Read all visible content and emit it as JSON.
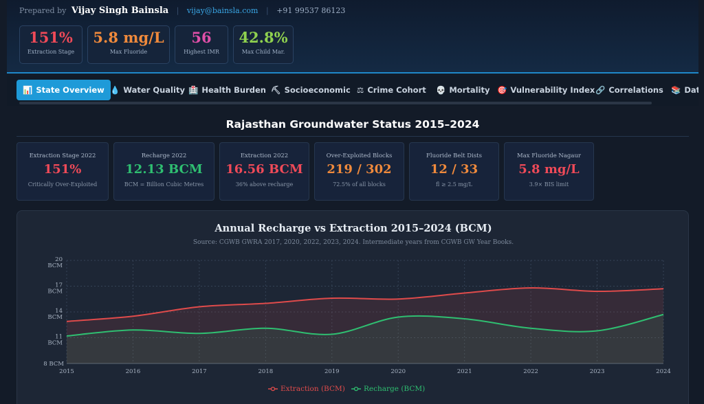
{
  "header": {
    "prepared_label": "Prepared by",
    "author": "Vijay Singh Bainsla",
    "email": "vijay@bainsla.com",
    "phone": "+91 99537 86123",
    "stats": [
      {
        "value": "151%",
        "label": "Extraction Stage",
        "color": "#ef4a58"
      },
      {
        "value": "5.8 mg/L",
        "label": "Max Fluoride",
        "color": "#f08a3c"
      },
      {
        "value": "56",
        "label": "Highest IMR",
        "color": "#e04fa8"
      },
      {
        "value": "42.8%",
        "label": "Max Child Mar.",
        "color": "#8fd14f"
      }
    ]
  },
  "tabs": [
    {
      "icon": "📊",
      "label": "State Overview",
      "active": true
    },
    {
      "icon": "💧",
      "label": "Water Quality"
    },
    {
      "icon": "🏥",
      "label": "Health Burden"
    },
    {
      "icon": "⛏",
      "label": "Socioeconomic"
    },
    {
      "icon": "⚖",
      "label": "Crime Cohort"
    },
    {
      "icon": "💀",
      "label": "Mortality"
    },
    {
      "icon": "🎯",
      "label": "Vulnerability Index"
    },
    {
      "icon": "🔗",
      "label": "Correlations"
    },
    {
      "icon": "📚",
      "label": "Data"
    }
  ],
  "page_title": "Rajasthan Groundwater Status 2015–2024",
  "cards": [
    {
      "label": "Extraction Stage 2022",
      "value": "151%",
      "sub": "Critically Over-Exploited",
      "color": "#ef4a58"
    },
    {
      "label": "Recharge 2022",
      "value": "12.13 BCM",
      "sub": "BCM = Billion Cubic Metres",
      "color": "#2fbf71"
    },
    {
      "label": "Extraction 2022",
      "value": "16.56 BCM",
      "sub": "36% above recharge",
      "color": "#ef4a58"
    },
    {
      "label": "Over-Exploited Blocks",
      "value": "219 / 302",
      "sub": "72.5% of all blocks",
      "color": "#f08a3c"
    },
    {
      "label": "Fluoride Belt Dists",
      "value": "12 / 33",
      "sub": "fl ≥ 2.5 mg/L",
      "color": "#f08a3c"
    },
    {
      "label": "Max Fluoride Nagaur",
      "value": "5.8 mg/L",
      "sub": "3.9× BIS limit",
      "color": "#ef4a58"
    }
  ],
  "chart_data": {
    "type": "line",
    "title": "Annual Recharge vs Extraction 2015–2024 (BCM)",
    "subtitle": "Source: CGWB GWRA 2017, 2020, 2022, 2023, 2024. Intermediate years from CGWB GW Year Books.",
    "x": [
      2015,
      2016,
      2017,
      2018,
      2019,
      2020,
      2021,
      2022,
      2023,
      2024
    ],
    "y_ticks": [
      8,
      11,
      14,
      17,
      20
    ],
    "y_unit": "BCM",
    "ylim": [
      8,
      20
    ],
    "legend_position": "bottom",
    "grid": true,
    "series": [
      {
        "name": "Extraction (BCM)",
        "color": "#e04b4b",
        "values": [
          12.9,
          13.5,
          14.6,
          15.0,
          15.6,
          15.5,
          16.2,
          16.8,
          16.4,
          16.7
        ]
      },
      {
        "name": "Recharge (BCM)",
        "color": "#2fbf71",
        "values": [
          11.2,
          11.9,
          11.5,
          12.1,
          11.4,
          13.4,
          13.2,
          12.1,
          11.8,
          13.7
        ]
      }
    ]
  }
}
